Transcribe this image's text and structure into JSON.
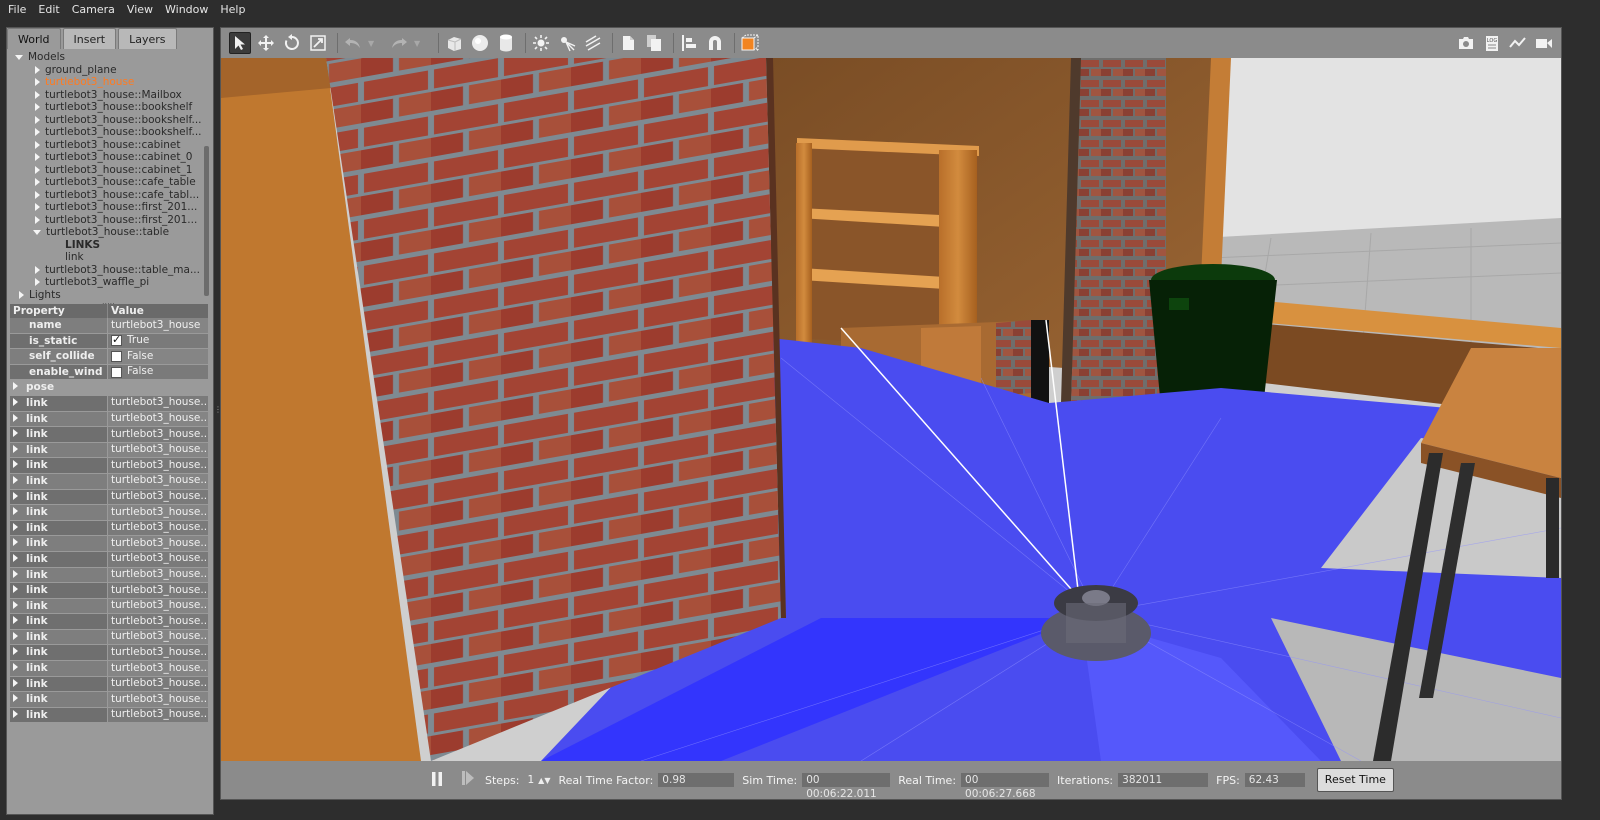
{
  "menu": {
    "items": [
      "File",
      "Edit",
      "Camera",
      "View",
      "Window",
      "Help"
    ]
  },
  "left_panel": {
    "tabs": [
      "World",
      "Insert",
      "Layers"
    ],
    "tree": {
      "models_label": "Models",
      "items": [
        "ground_plane",
        "turtlebot3_house",
        "turtlebot3_house::Mailbox",
        "turtlebot3_house::bookshelf",
        "turtlebot3_house::bookshelf...",
        "turtlebot3_house::bookshelf...",
        "turtlebot3_house::cabinet",
        "turtlebot3_house::cabinet_0",
        "turtlebot3_house::cabinet_1",
        "turtlebot3_house::cafe_table",
        "turtlebot3_house::cafe_tabl...",
        "turtlebot3_house::first_201...",
        "turtlebot3_house::first_201...",
        "turtlebot3_house::table"
      ],
      "links_label": "LINKS",
      "link_label": "link",
      "items_after": [
        "turtlebot3_house::table_ma...",
        "turtlebot3_waffle_pi"
      ],
      "lights_label": "Lights"
    },
    "properties": {
      "header_property": "Property",
      "header_value": "Value",
      "name_key": "name",
      "name_value": "turtlebot3_house",
      "is_static_key": "is_static",
      "is_static_value": "True",
      "self_collide_key": "self_collide",
      "self_collide_value": "False",
      "enable_wind_key": "enable_wind",
      "enable_wind_value": "False",
      "pose_key": "pose",
      "link_key": "link",
      "link_value": "turtlebot3_house...",
      "link_count": 21
    }
  },
  "toolbar": {
    "icons": [
      "select-arrow-icon",
      "translate-icon",
      "rotate-icon",
      "scale-icon",
      "undo-icon",
      "redo-icon",
      "box-icon",
      "sphere-icon",
      "cylinder-icon",
      "point-light-icon",
      "spot-light-icon",
      "directional-light-icon",
      "copy-icon",
      "paste-icon",
      "align-icon",
      "snap-magnet-icon",
      "view-angle-icon",
      "screenshot-icon",
      "log-icon",
      "plot-icon",
      "video-icon"
    ]
  },
  "bottom": {
    "steps_label": "Steps:",
    "steps_value": "1",
    "rtf_label": "Real Time Factor:",
    "rtf_value": "0.98",
    "sim_time_label": "Sim Time:",
    "sim_time_value": "00 00:06:22.011",
    "real_time_label": "Real Time:",
    "real_time_value": "00 00:06:27.668",
    "iterations_label": "Iterations:",
    "iterations_value": "382011",
    "fps_label": "FPS:",
    "fps_value": "62.43",
    "reset_label": "Reset Time"
  },
  "colors": {
    "selected_text": "#ff7b21",
    "laser": "#2a2cff",
    "brick": "#a34434"
  }
}
